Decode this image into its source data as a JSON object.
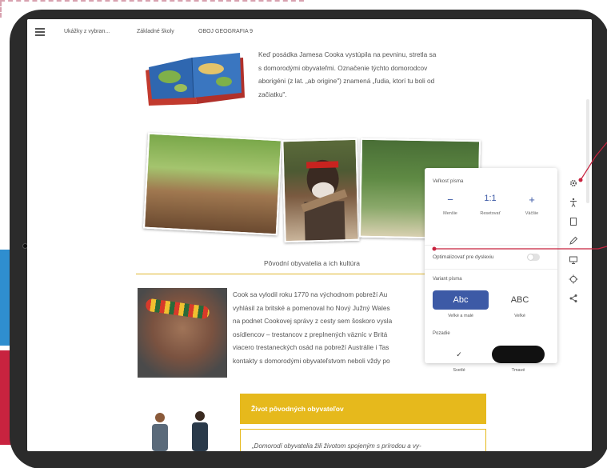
{
  "nav": {
    "crumbs": [
      "Ukážky z vybran...",
      "Základné školy",
      "OBOJ GEOGRAFIA 9"
    ]
  },
  "intro": {
    "lines": [
      "Keď posádka Jamesa Cooka vystúpila na pevninu, stretla sa",
      "s domorodými obyvateľmi. Označenie týchto domorodcov",
      "aborigéni (z lat. „ab origine\") znamená „ľudia, ktorí tu boli od",
      "začiatku\"."
    ]
  },
  "section": {
    "title": "Pôvodní obyvatelia a ich kultúra",
    "lines": [
      "Cook sa vylodil roku 1770 na východnom pobreží Au",
      "vyhlásil za britské a pomenoval ho Nový Južný Wales",
      "na podnet Cookovej správy z cesty sem šoskoro vysla",
      "osídlencov – trestancov z preplnených väzníc v Britá",
      "viacero trestaneckých osád na pobreží Austrálie i Tas",
      "kontakty s domorodými obyvateľstvom neboli vždy po"
    ]
  },
  "feature": {
    "title": "Život pôvodných obyvateľov",
    "quote": "„Domorodí obyvatelia žili životom spojeným s prírodou a vy-"
  },
  "settings": {
    "font_size_title": "Veľkosť písma",
    "decrease_symbol": "−",
    "decrease_caption": "Menšie",
    "reset_symbol": "1:1",
    "reset_caption": "Resetovať",
    "increase_symbol": "+",
    "increase_caption": "Väčšie",
    "dyslexia_label": "Optimalizovať pre dyslexiu",
    "font_variant_title": "Variant písma",
    "variant_mixed_text": "Abc",
    "variant_mixed_caption": "Veľké a malé",
    "variant_upper_text": "ABC",
    "variant_upper_caption": "Veľké",
    "background_title": "Pozadie",
    "bg_light_symbol": "✓",
    "bg_light_caption": "Svetlé",
    "bg_dark_caption": "Tmavé"
  },
  "tools": [
    "gear-icon",
    "accessibility-icon",
    "bookmark-icon",
    "pencil-icon",
    "monitor-icon",
    "crosshair-icon",
    "share-icon"
  ],
  "colors": {
    "accent_blue": "#3d5aa6",
    "accent_yellow": "#e6b91c",
    "callout_red": "#c8233f",
    "tablet_frame": "#2b2b2b"
  }
}
